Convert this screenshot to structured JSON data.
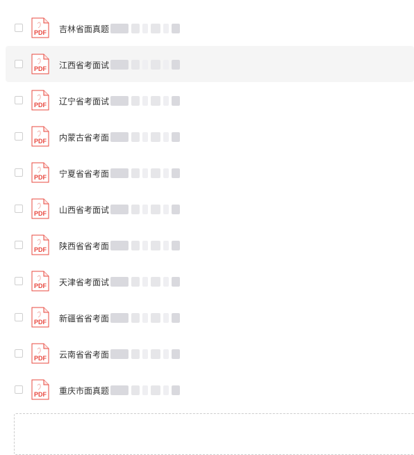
{
  "files": [
    {
      "name": "吉林省面真题",
      "type": "PDF"
    },
    {
      "name": "江西省考面试",
      "type": "PDF"
    },
    {
      "name": "辽宁省考面试",
      "type": "PDF"
    },
    {
      "name": "内蒙古省考面",
      "type": "PDF"
    },
    {
      "name": "宁夏省省考面",
      "type": "PDF"
    },
    {
      "name": "山西省考面试",
      "type": "PDF"
    },
    {
      "name": "陕西省省考面",
      "type": "PDF"
    },
    {
      "name": "天津省考面试",
      "type": "PDF"
    },
    {
      "name": "新疆省省考面",
      "type": "PDF"
    },
    {
      "name": "云南省省考面",
      "type": "PDF"
    },
    {
      "name": "重庆市面真题",
      "type": "PDF"
    }
  ],
  "colors": {
    "pdf_red": "#e8483f",
    "hover_bg": "#f5f5f5",
    "text": "#333333"
  }
}
